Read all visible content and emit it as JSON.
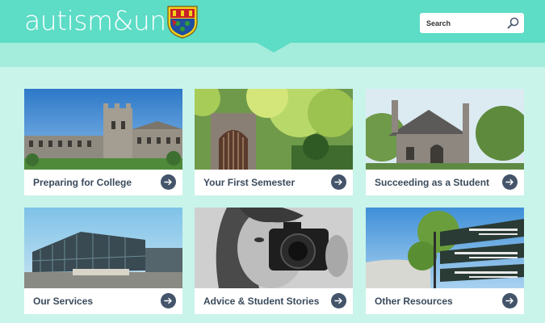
{
  "site": {
    "logo_text": "autism&uni"
  },
  "search": {
    "placeholder": "Search"
  },
  "cards": [
    {
      "label": "Preparing for College",
      "image": "university-quad-building"
    },
    {
      "label": "Your First Semester",
      "image": "gothic-archway-garden"
    },
    {
      "label": "Succeeding as a Student",
      "image": "stone-lodge-trees"
    },
    {
      "label": "Our Services",
      "image": "modern-glass-building"
    },
    {
      "label": "Advice & Student Stories",
      "image": "student-with-camera"
    },
    {
      "label": "Other Resources",
      "image": "campus-signpost"
    }
  ],
  "colors": {
    "header": "#5ddcc6",
    "band": "#a4ecdc",
    "background": "#c9f4ea",
    "label_text": "#3a4a5c",
    "arrow_button": "#44546a"
  }
}
